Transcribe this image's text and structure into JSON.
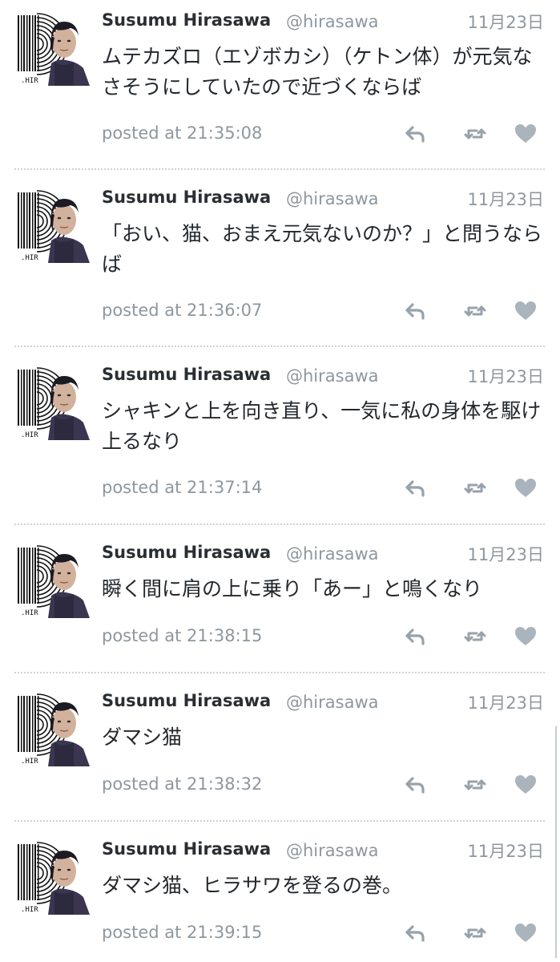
{
  "colors": {
    "name": "#2a2e33",
    "muted": "#8e979f",
    "icon": "#98a2ab",
    "heart": "#aab4bd",
    "divider": "#cdd3d9",
    "text": "#24282c"
  },
  "icons": {
    "reply": "reply-icon",
    "retweet": "retweet-icon",
    "like": "heart-icon",
    "avatar": "avatar-image"
  },
  "avatar_caption": ".HIR",
  "tweets": [
    {
      "name": "Susumu Hirasawa",
      "handle": "@hirasawa",
      "date": "11月23日",
      "text": "ムテカズロ（エゾボカシ）（ケトン体）が元気なさそうにしていたので近づくならば",
      "posted": "posted at 21:35:08"
    },
    {
      "name": "Susumu Hirasawa",
      "handle": "@hirasawa",
      "date": "11月23日",
      "text": "「おい、猫、おまえ元気ないのか？」と問うならば",
      "posted": "posted at 21:36:07"
    },
    {
      "name": "Susumu Hirasawa",
      "handle": "@hirasawa",
      "date": "11月23日",
      "text": "シャキンと上を向き直り、一気に私の身体を駆け上るなり",
      "posted": "posted at 21:37:14"
    },
    {
      "name": "Susumu Hirasawa",
      "handle": "@hirasawa",
      "date": "11月23日",
      "text": "瞬く間に肩の上に乗り「あー」と鳴くなり",
      "posted": "posted at 21:38:15"
    },
    {
      "name": "Susumu Hirasawa",
      "handle": "@hirasawa",
      "date": "11月23日",
      "text": "ダマシ猫",
      "posted": "posted at 21:38:32"
    },
    {
      "name": "Susumu Hirasawa",
      "handle": "@hirasawa",
      "date": "11月23日",
      "text": "ダマシ猫、ヒラサワを登るの巻。",
      "posted": "posted at 21:39:15"
    }
  ]
}
